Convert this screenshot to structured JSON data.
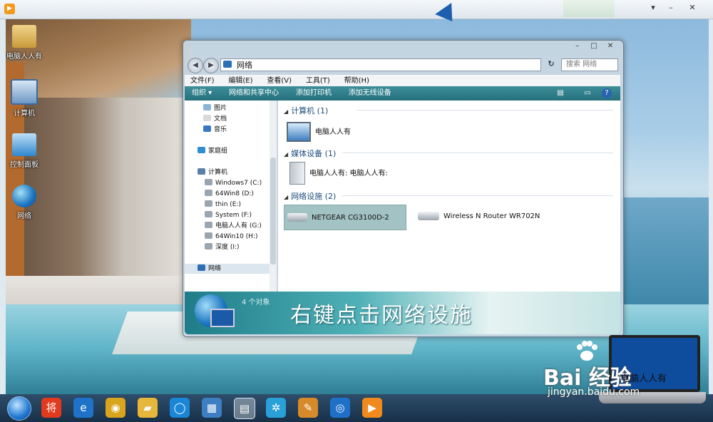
{
  "outer_window": {
    "controls": [
      "▾",
      "–",
      "✕"
    ]
  },
  "desktop": {
    "icons": [
      {
        "name": "user-folder",
        "label": "电脑人人有"
      },
      {
        "name": "computer",
        "label": "计算机"
      },
      {
        "name": "control-panel",
        "label": "控制面板"
      },
      {
        "name": "network",
        "label": "网络"
      }
    ]
  },
  "explorer": {
    "window_controls": [
      "–",
      "□",
      "✕"
    ],
    "address": "网络",
    "search_placeholder": "搜索 网络",
    "menu": [
      "文件(F)",
      "编辑(E)",
      "查看(V)",
      "工具(T)",
      "帮助(H)"
    ],
    "toolbar": [
      "组织 ▾",
      "网络和共享中心",
      "添加打印机",
      "添加无线设备"
    ],
    "nav": [
      {
        "label": "图片",
        "color": "#8ab4da"
      },
      {
        "label": "文档",
        "color": "#d9d9d9"
      },
      {
        "label": "音乐",
        "color": "#3a78c4"
      },
      {
        "label": "家庭组",
        "color": "#2d8fd2"
      },
      {
        "label": "计算机",
        "color": "#5a7fa8"
      },
      {
        "label": "Windows7 (C:)",
        "color": "#9aa5b0"
      },
      {
        "label": "64Win8  (D:)",
        "color": "#9aa5b0"
      },
      {
        "label": "thin (E:)",
        "color": "#9aa5b0"
      },
      {
        "label": "System (F:)",
        "color": "#9aa5b0"
      },
      {
        "label": "电脑人人有 (G:)",
        "color": "#9aa5b0"
      },
      {
        "label": "64Win10 (H:)",
        "color": "#9aa5b0"
      },
      {
        "label": "深度 (I:)",
        "color": "#9aa5b0"
      },
      {
        "label": "网络",
        "color": "#2e6fb4"
      }
    ],
    "groups": [
      {
        "title": "计算机 (1)",
        "items": [
          "电脑人人有"
        ]
      },
      {
        "title": "媒体设备 (1)",
        "items": [
          "电脑人人有: 电脑人人有:"
        ]
      },
      {
        "title": "网络设施 (2)",
        "items": [
          "NETGEAR CG3100D-2",
          "Wireless N Router WR702N"
        ]
      }
    ],
    "status_count": "4 个对象",
    "caption": "右键点击网络设施"
  },
  "taskbar": {
    "icons": [
      {
        "name": "jiang-app",
        "glyph": "将",
        "color": "#e23a1f"
      },
      {
        "name": "ie",
        "glyph": "e",
        "color": "#1e73c9"
      },
      {
        "name": "chrome",
        "glyph": "◉",
        "color": "#d9a51c"
      },
      {
        "name": "folder",
        "glyph": "▰",
        "color": "#e6b73a"
      },
      {
        "name": "search",
        "glyph": "◯",
        "color": "#1a86d6"
      },
      {
        "name": "device-manager",
        "glyph": "▦",
        "color": "#3c7fc2"
      },
      {
        "name": "explorer-active",
        "glyph": "▤",
        "color": "#e0a93a"
      },
      {
        "name": "pinwheel",
        "glyph": "✲",
        "color": "#2aa0d8"
      },
      {
        "name": "paint",
        "glyph": "✎",
        "color": "#d68a2a"
      },
      {
        "name": "media-center",
        "glyph": "◎",
        "color": "#1f70c8"
      },
      {
        "name": "video-player",
        "glyph": "▶",
        "color": "#f08a1c"
      }
    ]
  },
  "watermark": {
    "brand": "Bai 经验",
    "site": "jingyan.baidu.com",
    "laptop_text": "电脑人人有"
  },
  "colors": {
    "toolbar_teal": "#2d7f8a",
    "accent_blue": "#1a4b7c",
    "selection": "#9fbcc0"
  }
}
